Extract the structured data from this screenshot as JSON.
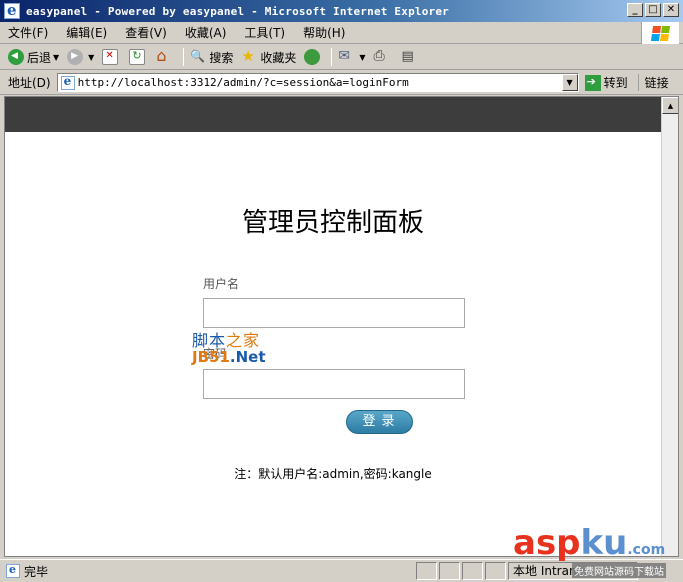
{
  "window": {
    "title": "easypanel - Powered by easypanel - Microsoft Internet Explorer",
    "controls": {
      "minimize": "_",
      "maximize": "□",
      "close": "✕"
    }
  },
  "menu": [
    "文件(F)",
    "编辑(E)",
    "查看(V)",
    "收藏(A)",
    "工具(T)",
    "帮助(H)"
  ],
  "toolbar": {
    "back_label": "后退",
    "search_label": "搜索",
    "favorites_label": "收藏夹"
  },
  "address": {
    "label": "地址(D)",
    "url": "http://localhost:3312/admin/?c=session&a=loginForm",
    "go_label": "转到",
    "links_label": "链接"
  },
  "page": {
    "title": "管理员控制面板",
    "username_label": "用户名",
    "password_label": "密码",
    "login_button": "登录",
    "note": "注：默认用户名:admin,密码:kangle"
  },
  "watermarks": {
    "jb51_line1_a": "脚本",
    "jb51_line1_b": "之家",
    "jb51_line2_a": "JB51",
    "jb51_line2_b": ".Net",
    "aspku_a": "asp",
    "aspku_b": "ku",
    "aspku_c": ".com",
    "aspku_sub": "免费网站源码下载站"
  },
  "status": {
    "text": "完毕",
    "zone": "本地 Intranet"
  },
  "colors": {
    "title_bar_start": "#0a246a",
    "title_bar_end": "#a6caf0",
    "header_strip": "#3d3d3d",
    "login_button": "#2c7ca4",
    "chrome": "#d4d0c8"
  }
}
